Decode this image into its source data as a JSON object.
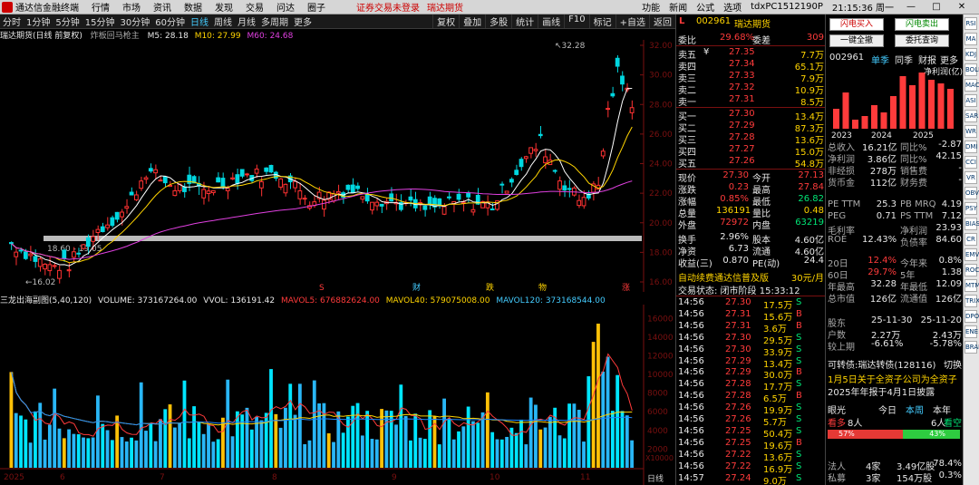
{
  "titlebar": {
    "app": "通达信金融终端",
    "menu": [
      "行情",
      "市场",
      "资讯",
      "数据",
      "发现",
      "交易",
      "问达",
      "圈子"
    ],
    "warning": "证券交易未登录",
    "right_label": "瑞达期货",
    "right": [
      "功能",
      "新闻",
      "公式",
      "选项"
    ],
    "user": "tdxPC1512190P",
    "time": "21:15:36 周一"
  },
  "toolbar": {
    "periods": [
      "分时",
      "1分钟",
      "5分钟",
      "15分钟",
      "30分钟",
      "60分钟",
      "日线",
      "周线",
      "月线",
      "多周期",
      "更多"
    ],
    "active": "日线",
    "tools": [
      "复权",
      "叠加",
      "多股",
      "统计",
      "画线",
      "F10",
      "标记",
      "+自选",
      "返回"
    ]
  },
  "kline": {
    "title": "瑞达期货(日线 前复权)",
    "formula": "炸板回马枪主",
    "ma5": "M5: 28.18",
    "ma10": "M10: 27.99",
    "ma60": "M60: 24.68",
    "yticks": [
      "32.00",
      "30.00",
      "28.00",
      "26.00",
      "24.00",
      "22.00",
      "20.00",
      "18.00",
      "16.00"
    ],
    "high_label": "32.28",
    "low_label": "16.02",
    "range_label": "18.60 - 19.05",
    "markers": [
      "S",
      "财",
      "跌",
      "物",
      "涨"
    ]
  },
  "volume": {
    "title": "三龙出海副图(5,40,120)",
    "volume": "VOLUME: 373167264.00",
    "vvol": "VVOL: 136191.42",
    "mavol5": "MAVOL5: 676882624.00",
    "mavol40": "MAVOL40: 579075008.00",
    "mavol120": "MAVOL120: 373168544.00",
    "yticks": [
      "16000",
      "14000",
      "12000",
      "10000",
      "8000",
      "6000",
      "4000",
      "2000"
    ],
    "unit": "X10000",
    "xlabels": [
      "2025",
      "6",
      "7",
      "8",
      "9",
      "10",
      "11"
    ],
    "xaxis_label": "日线"
  },
  "quote": {
    "code": "002961",
    "name": "瑞达期货",
    "wb_label": "委比",
    "wb": "29.68%",
    "wc_label": "委差",
    "wc": "309",
    "asks": [
      [
        "卖五",
        "¥",
        "27.35",
        "7.7万"
      ],
      [
        "卖四",
        "",
        "27.34",
        "65.1万"
      ],
      [
        "卖三",
        "",
        "27.33",
        "7.9万"
      ],
      [
        "卖二",
        "",
        "27.32",
        "10.9万"
      ],
      [
        "卖一",
        "",
        "27.31",
        "8.5万"
      ]
    ],
    "bids": [
      [
        "买一",
        "27.30",
        "13.4万"
      ],
      [
        "买二",
        "27.29",
        "87.3万"
      ],
      [
        "买三",
        "27.28",
        "13.6万"
      ],
      [
        "买四",
        "27.27",
        "15.0万"
      ],
      [
        "买五",
        "27.26",
        "54.8万"
      ]
    ],
    "stats": [
      [
        "现价",
        "27.30",
        "今开",
        "27.13"
      ],
      [
        "涨跌",
        "0.23",
        "最高",
        "27.84"
      ],
      [
        "涨幅",
        "0.85%",
        "最低",
        "26.82"
      ],
      [
        "总量",
        "136191",
        "量比",
        "0.48"
      ],
      [
        "外盘",
        "72972",
        "内盘",
        "63219"
      ],
      [
        "换手",
        "2.96%",
        "股本",
        "4.60亿"
      ],
      [
        "净资",
        "6.73",
        "流通",
        "4.60亿"
      ],
      [
        "收益(三)",
        "0.870",
        "PE(动)",
        "24.4"
      ]
    ],
    "promo": "自动续费通达信普及版",
    "promo_price": "30元/月",
    "status": "交易状态: 闭市阶段 15:33:12",
    "ticks": [
      [
        "14:56",
        "27.30",
        "17.5万",
        "S"
      ],
      [
        "14:56",
        "27.31",
        "15.6万",
        "B"
      ],
      [
        "14:56",
        "27.31",
        "3.6万",
        "B"
      ],
      [
        "14:56",
        "27.30",
        "29.5万",
        "S"
      ],
      [
        "14:56",
        "27.30",
        "33.9万",
        "S"
      ],
      [
        "14:56",
        "27.29",
        "13.4万",
        "S"
      ],
      [
        "14:56",
        "27.29",
        "30.0万",
        "B"
      ],
      [
        "14:56",
        "27.28",
        "17.7万",
        "S"
      ],
      [
        "14:56",
        "27.28",
        "6.5万",
        "B"
      ],
      [
        "14:56",
        "27.26",
        "19.9万",
        "S"
      ],
      [
        "14:56",
        "27.26",
        "5.7万",
        "S"
      ],
      [
        "14:56",
        "27.25",
        "50.4万",
        "S"
      ],
      [
        "14:56",
        "27.25",
        "19.6万",
        "B"
      ],
      [
        "14:56",
        "27.22",
        "13.6万",
        "S"
      ],
      [
        "14:56",
        "27.22",
        "16.9万",
        "S"
      ],
      [
        "14:57",
        "27.24",
        "9.0万",
        "S"
      ]
    ]
  },
  "far": {
    "btn_buy": "闪电买入",
    "btn_sell": "闪电卖出",
    "btn_all": "一键全撤",
    "btn_query": "委托查询",
    "code": "002961",
    "tabs": [
      "单季",
      "同季",
      "财报",
      "更多"
    ],
    "chart_title": "净利润(亿)",
    "years": [
      "2023",
      "2024",
      "2025"
    ],
    "fin": [
      [
        "总收入",
        "16.21亿",
        "同比%",
        "-2.87"
      ],
      [
        "净利润",
        "3.86亿",
        "同比%",
        "42.15"
      ],
      [
        "非经损",
        "278万",
        "销售费",
        "-"
      ],
      [
        "货币金",
        "112亿",
        "财务费",
        "-"
      ]
    ],
    "val": [
      [
        "PE TTM",
        "25.3",
        "PB MRQ",
        "4.19"
      ],
      [
        "PEG",
        "0.71",
        "PS TTM",
        "7.12"
      ],
      [
        "毛利率",
        "",
        "净利润",
        "23.93"
      ],
      [
        "ROE",
        "12.43%",
        "负债率",
        "84.60"
      ]
    ],
    "perf": [
      [
        "20日",
        "12.4%",
        "今年来",
        "0.8%"
      ],
      [
        "60日",
        "29.7%",
        "5年",
        "1.38"
      ],
      [
        "年最高",
        "32.28",
        "年最低",
        "12.09"
      ],
      [
        "总市值",
        "126亿",
        "流通值",
        "126亿"
      ]
    ],
    "holders": [
      [
        "股东",
        "25-11-30",
        "25-11-20"
      ],
      [
        "户数",
        "2.27万",
        "2.43万"
      ],
      [
        "较上期",
        "-6.61%",
        "-5.78%"
      ]
    ],
    "bond": "可转债:瑞达转债(128116)",
    "bond_switch": "切换",
    "notice1": "1月5日关于全资子公司为全资子",
    "notice2": "2025年年报于4月1日披露",
    "vote_title": "眼光",
    "vote_tabs": [
      "今日",
      "本周",
      "本年"
    ],
    "bull_label": "看多",
    "bull_count": "8人",
    "bear_count": "6人",
    "bear_label": "看空",
    "bull_pct": "57%",
    "bear_pct": "43%",
    "flow": [
      [
        "法人",
        "4家",
        "3.49亿股",
        "78.4%"
      ],
      [
        "私募",
        "3家",
        "154万股",
        "0.3%"
      ]
    ]
  },
  "sidebar": [
    "RSI",
    "MA",
    "KDJ",
    "BOLL",
    "MACD",
    "ASI",
    "SAR",
    "WR",
    "DMI",
    "CCI",
    "VR",
    "OBV",
    "PSY",
    "BIAS",
    "CR",
    "EMV",
    "ROC",
    "MTM",
    "TRIX",
    "DPO",
    "ENE",
    "BRAR"
  ]
}
